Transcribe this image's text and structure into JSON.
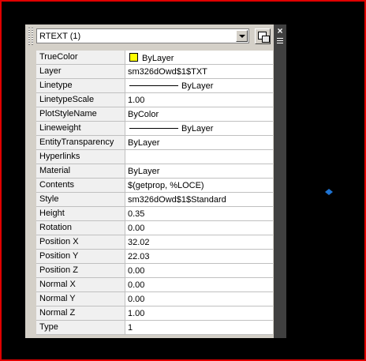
{
  "palette": {
    "selector": {
      "value": "RTEXT (1)"
    },
    "properties": [
      {
        "name": "TrueColor",
        "value": "ByLayer",
        "glyph": "swatch",
        "swatch_color": "#ffff00"
      },
      {
        "name": "Layer",
        "value": "sm326dOwd$1$TXT"
      },
      {
        "name": "Linetype",
        "value": "ByLayer",
        "glyph": "line"
      },
      {
        "name": "LinetypeScale",
        "value": "1.00"
      },
      {
        "name": "PlotStyleName",
        "value": "ByColor"
      },
      {
        "name": "Lineweight",
        "value": "ByLayer",
        "glyph": "line"
      },
      {
        "name": "EntityTransparency",
        "value": "ByLayer"
      },
      {
        "name": "Hyperlinks",
        "value": ""
      },
      {
        "name": "Material",
        "value": "ByLayer"
      },
      {
        "name": "Contents",
        "value": "$(getprop, %LOCE)"
      },
      {
        "name": "Style",
        "value": "sm326dOwd$1$Standard"
      },
      {
        "name": "Height",
        "value": "0.35"
      },
      {
        "name": "Rotation",
        "value": "0.00"
      },
      {
        "name": "Position X",
        "value": "32.02"
      },
      {
        "name": "Position Y",
        "value": "22.03"
      },
      {
        "name": "Position Z",
        "value": "0.00"
      },
      {
        "name": "Normal X",
        "value": "0.00"
      },
      {
        "name": "Normal Y",
        "value": "0.00"
      },
      {
        "name": "Normal Z",
        "value": "1.00"
      },
      {
        "name": "Type",
        "value": "1"
      }
    ]
  },
  "icons": {
    "close": "close-icon",
    "menu": "menu-icon",
    "quick_select": "quick-select-icon",
    "dropdown": "chevron-down-icon",
    "grip": "grip-point-icon"
  },
  "colors": {
    "accent_grip": "#1e73d2",
    "frame": "#e00000"
  }
}
